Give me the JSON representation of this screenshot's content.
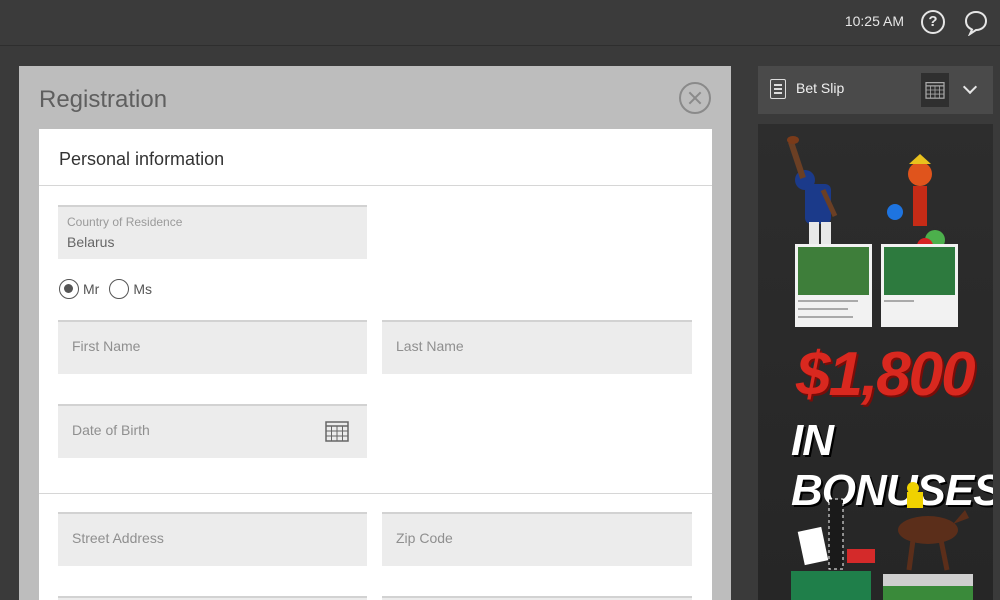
{
  "topbar": {
    "time": "10:25 AM",
    "help_icon": "help-circle-icon",
    "chat_icon": "chat-bubble-icon"
  },
  "registration": {
    "title": "Registration",
    "section_title": "Personal information",
    "country_label": "Country of Residence",
    "country_value": "Belarus",
    "title_options": [
      "Mr",
      "Ms"
    ],
    "selected_title": "Mr",
    "first_name_placeholder": "First Name",
    "last_name_placeholder": "Last Name",
    "dob_placeholder": "Date of Birth",
    "street_placeholder": "Street Address",
    "zip_placeholder": "Zip Code"
  },
  "betslip": {
    "label": "Bet Slip"
  },
  "ad": {
    "amount": "$1,800",
    "bonus_text": "IN BONUSES"
  },
  "colors": {
    "amount_red": "#d9281f",
    "panel_grey": "#bdbdbd",
    "field_grey": "#ececec"
  }
}
